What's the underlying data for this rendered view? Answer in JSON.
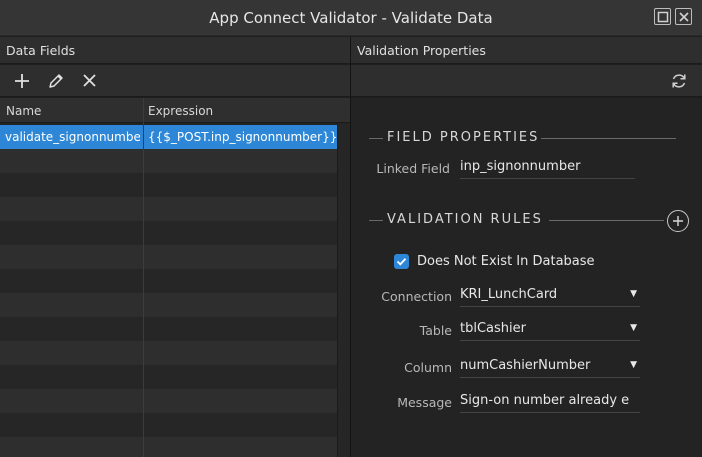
{
  "window": {
    "title": "App Connect Validator - Validate Data",
    "maximize_icon": "maximize-icon",
    "close_icon": "close-icon"
  },
  "left_panel": {
    "header": "Data Fields",
    "toolbar": {
      "icons": [
        "add-icon",
        "edit-pencil-icon",
        "delete-x-icon"
      ]
    },
    "table": {
      "columns": [
        "Name",
        "Expression"
      ],
      "rows": [
        {
          "name": "validate_signonnumber",
          "expression": "{{$_POST.inp_signonnumber}}",
          "selected": true
        }
      ]
    }
  },
  "right_panel": {
    "header": "Validation Properties",
    "refresh_icon": "refresh-icon",
    "field_properties": {
      "title": "FIELD PROPERTIES",
      "linked_field_label": "Linked Field",
      "linked_field_value": "inp_signonnumber"
    },
    "validation_rules": {
      "title": "VALIDATION RULES",
      "add_icon": "add-circle-icon",
      "rule": {
        "checked": true,
        "label": "Does Not Exist In Database"
      },
      "connection_label": "Connection",
      "connection_value": "KRI_LunchCard",
      "table_label": "Table",
      "table_value": "tblCashier",
      "column_label": "Column",
      "column_value": "numCashierNumber",
      "message_label": "Message",
      "message_value": "Sign-on number already e"
    }
  },
  "colors": {
    "accent": "#2d87d6",
    "background": "#232323",
    "header": "#2e2e2e"
  }
}
